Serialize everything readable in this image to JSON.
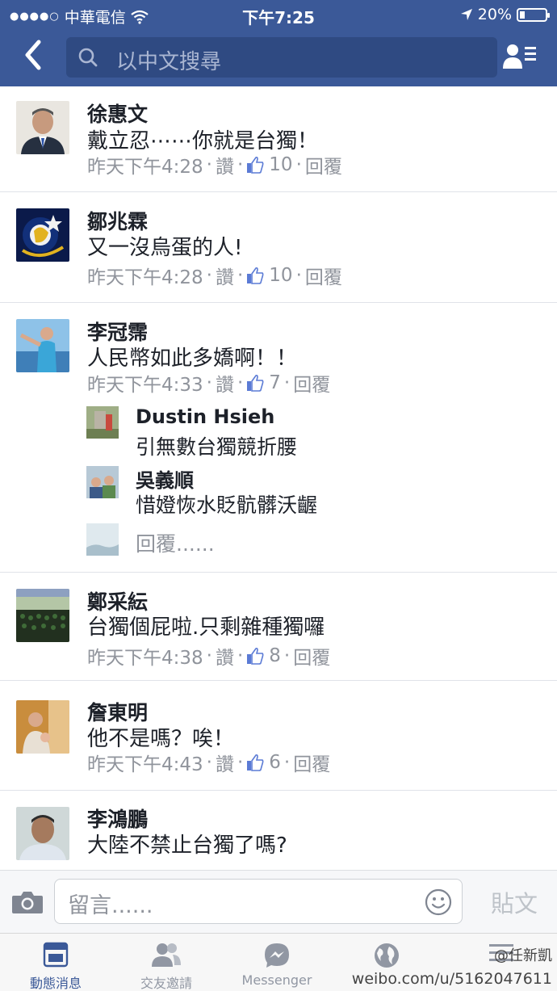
{
  "status_bar": {
    "signal_dots": "●●●●○",
    "carrier": "中華電信",
    "time": "下午7:25",
    "battery": "20%",
    "battery_level": 0.2
  },
  "header": {
    "search_placeholder": "以中文搜尋"
  },
  "comments": [
    {
      "name": "徐惠文",
      "text": "戴立忍⋯⋯你就是台獨！",
      "time": "昨天下午4:28",
      "like_label": "讚",
      "likes": "10",
      "reply_label": "回覆"
    },
    {
      "name": "鄒兆霖",
      "text": "又一沒烏蛋的人!",
      "time": "昨天下午4:28",
      "like_label": "讚",
      "likes": "10",
      "reply_label": "回覆"
    },
    {
      "name": "李冠霈",
      "text": "人民幣如此多嬌啊！！",
      "time": "昨天下午4:33",
      "like_label": "讚",
      "likes": "7",
      "reply_label": "回覆"
    },
    {
      "name": "鄭采紜",
      "text": "台獨個屁啦.只剩雜種獨囉",
      "time": "昨天下午4:38",
      "like_label": "讚",
      "likes": "8",
      "reply_label": "回覆"
    },
    {
      "name": "詹東明",
      "text": "他不是嗎？唉！",
      "time": "昨天下午4:43",
      "like_label": "讚",
      "likes": "6",
      "reply_label": "回覆"
    },
    {
      "name": "李鴻鵬",
      "text": "大陸不禁止台獨了嗎?"
    }
  ],
  "replies": [
    {
      "name": "Dustin Hsieh",
      "text": "引無數台獨競折腰"
    },
    {
      "name": "吳義順",
      "text": "惜嬁恢水貶骯髒沃齷"
    }
  ],
  "reply_prompt": "回覆......",
  "composer": {
    "placeholder": "留言......",
    "post_label": "貼文"
  },
  "tabs": [
    {
      "label": "動態消息",
      "icon": "news-feed-icon",
      "active": true
    },
    {
      "label": "交友邀請",
      "icon": "friend-requests-icon"
    },
    {
      "label": "Messenger",
      "icon": "messenger-icon"
    },
    {
      "label": "",
      "icon": "notifications-globe-icon"
    },
    {
      "label": "",
      "icon": "more-menu-icon"
    }
  ],
  "watermark": {
    "line1": "@任新凱",
    "line2": "weibo.com/u/5162047611"
  },
  "colors": {
    "brand": "#3b5998",
    "meta_gray": "#90949c"
  }
}
